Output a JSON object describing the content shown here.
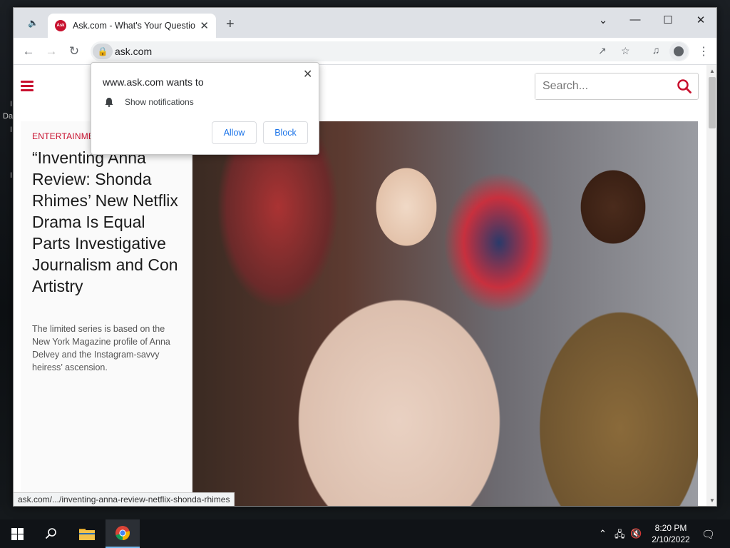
{
  "desktop": {
    "partial_labels": [
      "I",
      "Da",
      "I",
      "I"
    ]
  },
  "browser": {
    "tab": {
      "title": "Ask.com - What's Your Question?",
      "favicon_text": "Ask"
    },
    "url": "ask.com",
    "status_url": "ask.com/.../inventing-anna-review-netflix-shonda-rhimes"
  },
  "page": {
    "search_placeholder": "Search...",
    "accent_color": "#c8102e",
    "article": {
      "category": "ENTERTAINMENT",
      "headline": "“Inventing Anna Review: Shonda Rhimes’ New Netflix Drama Is Equal Parts Investigative Journalism and Con Artistry",
      "dek": "The limited series is based on the New York Magazine profile of Anna Delvey and the Instagram-savvy heiress’ ascension."
    }
  },
  "permission_prompt": {
    "title": "www.ask.com wants to",
    "item": "Show notifications",
    "allow_label": "Allow",
    "block_label": "Block"
  },
  "taskbar": {
    "time": "8:20 PM",
    "date": "2/10/2022"
  }
}
